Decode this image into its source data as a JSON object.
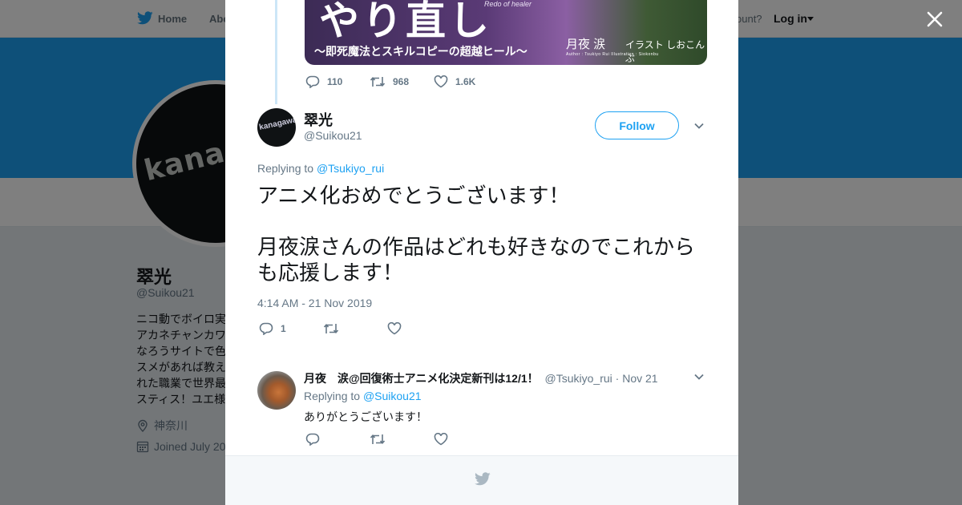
{
  "nav": {
    "home_label": "Home",
    "about_label": "Abo",
    "account_text": "ccount?",
    "login_label": "Log in"
  },
  "profile": {
    "name": "翠光",
    "handle": "@Suikou21",
    "bio": "ニコ動でボイロ実\nアカネチャンカワ\nなろうサイトで色\nスメがあれば教え\nれた職業で世界最\nスティス！ユエ様",
    "location": "神奈川",
    "joined": "Joined July 20"
  },
  "modal": {
    "parent_tweet": {
      "media": {
        "title_big": "やり直し",
        "title_sub": "Redo of healer",
        "strip": "〜即死魔法とスキルコピーの超越ヒール〜",
        "author": "月夜 涙",
        "illustrator": "イラスト しおこんぶ",
        "credits": "Author : Tsukiyo Rui    Illustration : Siokonbu"
      },
      "replies": "110",
      "retweets": "968",
      "likes": "1.6K"
    },
    "main_tweet": {
      "name": "翠光",
      "handle": "@Suikou21",
      "follow_label": "Follow",
      "replying_to_label": "Replying to",
      "replying_to_handle": "@Tsukiyo_rui",
      "text": "アニメ化おめでとうございます！\n\n月夜涙さんの作品はどれも好きなのでこれからも応援します！",
      "timestamp": "4:14 AM - 21 Nov 2019",
      "replies": "1"
    },
    "reply_tweet": {
      "name": "月夜　涙@回復術士アニメ化決定新刊は12/1！",
      "handle": "@Tsukiyo_rui",
      "date": "· Nov 21",
      "replying_to_label": "Replying to",
      "replying_to_handle": "@Suikou21",
      "text": "ありがとうございます！"
    }
  },
  "colors": {
    "brand_blue": "#1da1f2",
    "text_primary": "#14171a",
    "text_secondary": "#657786"
  },
  "icons": [
    "twitter-bird-icon",
    "close-icon",
    "reply-icon",
    "retweet-icon",
    "like-icon",
    "chevron-down-icon",
    "location-icon",
    "calendar-icon"
  ]
}
